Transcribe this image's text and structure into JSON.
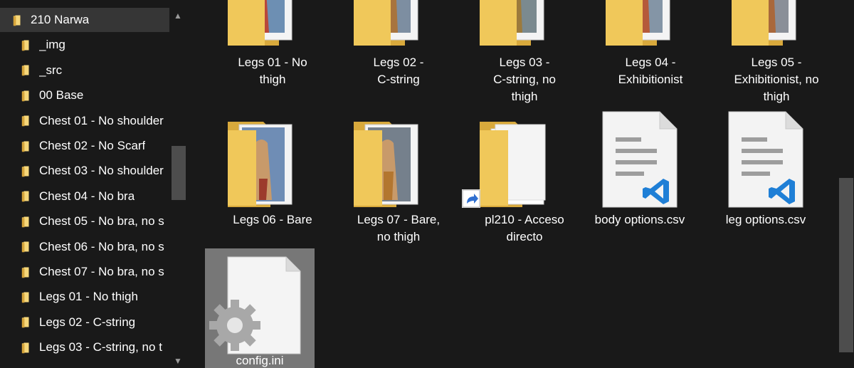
{
  "sidebar": {
    "items": [
      {
        "label": "210 Narwa",
        "selected": true
      },
      {
        "label": "_img"
      },
      {
        "label": "_src"
      },
      {
        "label": "00 Base"
      },
      {
        "label": "Chest 01 - No shoulder"
      },
      {
        "label": "Chest 02 - No Scarf"
      },
      {
        "label": "Chest 03 - No shoulder"
      },
      {
        "label": "Chest 04 - No bra"
      },
      {
        "label": "Chest 05 - No bra, no s"
      },
      {
        "label": "Chest 06 - No bra, no s"
      },
      {
        "label": "Chest 07 - No bra, no s"
      },
      {
        "label": "Legs 01 - No thigh"
      },
      {
        "label": "Legs 02 - C-string"
      },
      {
        "label": "Legs 03 - C-string, no t"
      }
    ],
    "scroll_up": "▲",
    "scroll_down": "▼"
  },
  "files": {
    "row1": [
      {
        "line1": "Legs 01 - No",
        "line2": "thigh",
        "line3": ""
      },
      {
        "line1": "Legs 02 -",
        "line2": "C-string",
        "line3": ""
      },
      {
        "line1": "Legs 03 -",
        "line2": "C-string, no",
        "line3": "thigh"
      },
      {
        "line1": "Legs 04 -",
        "line2": "Exhibitionist",
        "line3": ""
      },
      {
        "line1": "Legs 05 -",
        "line2": "Exhibitionist, no",
        "line3": "thigh"
      }
    ],
    "row2": [
      {
        "line1": "Legs 06 - Bare",
        "line2": ""
      },
      {
        "line1": "Legs 07 - Bare,",
        "line2": "no thigh"
      },
      {
        "line1": "pl210 - Acceso",
        "line2": "directo"
      },
      {
        "line1": "body options.csv",
        "line2": ""
      },
      {
        "line1": "leg options.csv",
        "line2": ""
      }
    ],
    "row3": [
      {
        "line1": "config.ini"
      }
    ]
  },
  "colors": {
    "background": "#191919",
    "folder": "#f0c85a",
    "folder_dark": "#d7a93c",
    "vscode_blue": "#1f7fd6",
    "selection": "#777777"
  },
  "icons": [
    "folder-icon",
    "shortcut-arrow-icon",
    "vscode-file-icon",
    "settings-file-icon"
  ]
}
